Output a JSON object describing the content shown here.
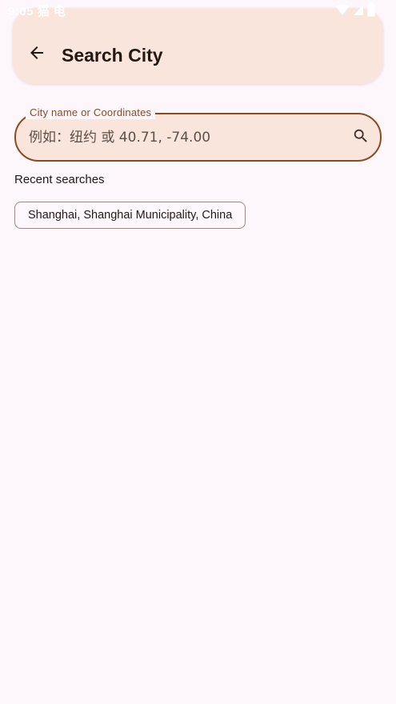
{
  "status_bar": {
    "time": "9:05",
    "notification_icons": [
      "猫",
      "电"
    ],
    "icons": [
      "wifi-icon",
      "signal-icon",
      "battery-icon"
    ]
  },
  "app_bar": {
    "title": "Search City",
    "back_icon": "arrow-back-icon"
  },
  "search": {
    "label": "City name or Coordinates",
    "placeholder": "例如：纽约 或 40.71, -74.00",
    "value": "",
    "icon": "search-icon"
  },
  "recent": {
    "heading": "Recent searches",
    "items": [
      "Shanghai, Shanghai Municipality, China"
    ]
  },
  "colors": {
    "background": "#fdf6fb",
    "surface": "#fae5dc",
    "outline": "#8a4a24",
    "on_surface": "#221a16"
  }
}
